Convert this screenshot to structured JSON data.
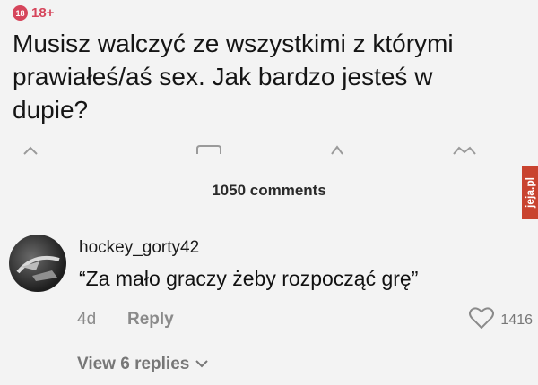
{
  "badge": {
    "number": "18",
    "label": "18+"
  },
  "post": {
    "title": "Musisz walczyć ze wszystkimi z którymi prawiałeś/aś sex. Jak bardzo jesteś w dupie?"
  },
  "actions": {
    "icons": [
      "chevron-up-icon",
      "comment-icon",
      "share-icon",
      "award-icon"
    ]
  },
  "comments_count": "1050 comments",
  "watermark": "jeja.pl",
  "comment": {
    "username": "hockey_gorty42",
    "text": "“Za mało graczy żeby rozpocząć grę”",
    "time": "4d",
    "reply_label": "Reply",
    "likes": "1416",
    "view_replies": "View 6 replies"
  },
  "colors": {
    "background": "#f3f3f3",
    "badge": "#d6455b",
    "watermark": "#c9432f",
    "muted": "#8a8a8a"
  }
}
